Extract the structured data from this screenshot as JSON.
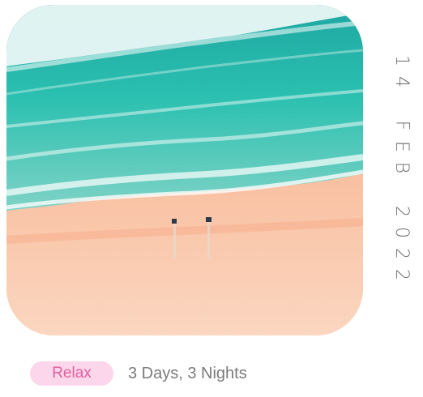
{
  "date": {
    "parts": [
      "14",
      "FEB",
      "2022"
    ]
  },
  "tag": {
    "label": "Relax"
  },
  "duration": {
    "text": "3 Days, 3 Nights"
  },
  "colors": {
    "tag_background": "#fcd6ea",
    "tag_text": "#e0609e",
    "date_text": "#6d6d6d",
    "duration_text": "#7a7a7a"
  }
}
